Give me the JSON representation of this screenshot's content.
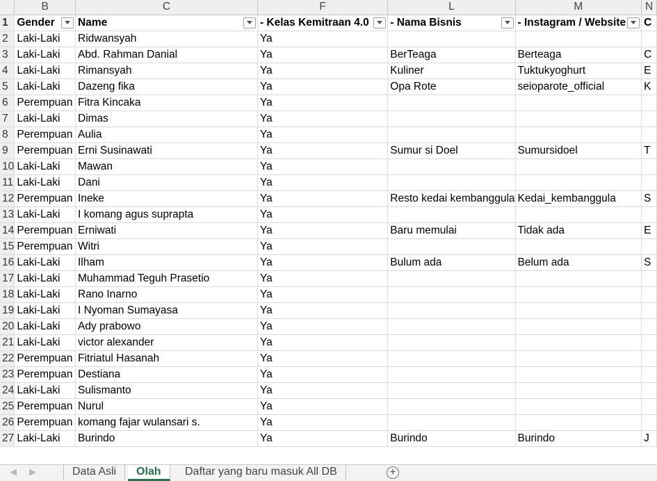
{
  "columns": [
    "B",
    "C",
    "F",
    "L",
    "M",
    "N"
  ],
  "header": {
    "row_number": "1",
    "cells": [
      "Gender",
      "Name",
      "- Kelas Kemitraan 4.0",
      "- Nama Bisnis",
      "- Instagram / Website",
      "C"
    ]
  },
  "rows": [
    {
      "n": "2",
      "cells": [
        "Laki-Laki",
        "Ridwansyah",
        "Ya",
        "",
        "",
        ""
      ]
    },
    {
      "n": "3",
      "cells": [
        "Laki-Laki",
        "Abd. Rahman Danial",
        "Ya",
        "BerTeaga",
        "Berteaga",
        "C"
      ]
    },
    {
      "n": "4",
      "cells": [
        "Laki-Laki",
        "Rimansyah",
        "Ya",
        "Kuliner",
        "Tuktukyoghurt",
        "E"
      ]
    },
    {
      "n": "5",
      "cells": [
        "Laki-Laki",
        "Dazeng fika",
        "Ya",
        "Opa Rote",
        "seioparote_official",
        "K"
      ]
    },
    {
      "n": "6",
      "cells": [
        "Perempuan",
        "Fitra Kincaka",
        "Ya",
        "",
        "",
        ""
      ]
    },
    {
      "n": "7",
      "cells": [
        "Laki-Laki",
        "Dimas",
        "Ya",
        "",
        "",
        ""
      ]
    },
    {
      "n": "8",
      "cells": [
        "Perempuan",
        "Aulia",
        "Ya",
        "",
        "",
        ""
      ]
    },
    {
      "n": "9",
      "cells": [
        "Perempuan",
        "Erni Susinawati",
        "Ya",
        "Sumur si Doel",
        "Sumursidoel",
        "T"
      ]
    },
    {
      "n": "10",
      "cells": [
        "Laki-Laki",
        "Mawan",
        "Ya",
        "",
        "",
        ""
      ]
    },
    {
      "n": "11",
      "cells": [
        "Laki-Laki",
        "Dani",
        "Ya",
        "",
        "",
        ""
      ]
    },
    {
      "n": "12",
      "cells": [
        "Perempuan",
        "Ineke",
        "Ya",
        "Resto kedai kembanggula",
        "Kedai_kembanggula",
        "S"
      ]
    },
    {
      "n": "13",
      "cells": [
        "Laki-Laki",
        "I komang agus suprapta",
        "Ya",
        "",
        "",
        ""
      ]
    },
    {
      "n": "14",
      "cells": [
        "Perempuan",
        "Erniwati",
        "Ya",
        "Baru memulai",
        "Tidak ada",
        "E"
      ]
    },
    {
      "n": "15",
      "cells": [
        "Perempuan",
        "Witri",
        "Ya",
        "",
        "",
        ""
      ]
    },
    {
      "n": "16",
      "cells": [
        "Laki-Laki",
        "Ilham",
        "Ya",
        "Bulum ada",
        "Belum ada",
        "S"
      ]
    },
    {
      "n": "17",
      "cells": [
        "Laki-Laki",
        "Muhammad Teguh Prasetio",
        "Ya",
        "",
        "",
        ""
      ]
    },
    {
      "n": "18",
      "cells": [
        "Laki-Laki",
        "Rano Inarno",
        "Ya",
        "",
        "",
        ""
      ]
    },
    {
      "n": "19",
      "cells": [
        "Laki-Laki",
        "I Nyoman Sumayasa",
        "Ya",
        "",
        "",
        ""
      ]
    },
    {
      "n": "20",
      "cells": [
        "Laki-Laki",
        "Ady prabowo",
        "Ya",
        "",
        "",
        ""
      ]
    },
    {
      "n": "21",
      "cells": [
        "Laki-Laki",
        "victor alexander",
        "Ya",
        "",
        "",
        ""
      ]
    },
    {
      "n": "22",
      "cells": [
        "Perempuan",
        "Fitriatul Hasanah",
        "Ya",
        "",
        "",
        ""
      ]
    },
    {
      "n": "23",
      "cells": [
        "Perempuan",
        "Destiana",
        "Ya",
        "",
        "",
        ""
      ]
    },
    {
      "n": "24",
      "cells": [
        "Laki-Laki",
        "Sulismanto",
        "Ya",
        "",
        "",
        ""
      ]
    },
    {
      "n": "25",
      "cells": [
        "Perempuan",
        "Nurul",
        "Ya",
        "",
        "",
        ""
      ]
    },
    {
      "n": "26",
      "cells": [
        "Perempuan",
        "komang fajar wulansari s.",
        "Ya",
        "",
        "",
        ""
      ]
    },
    {
      "n": "27",
      "cells": [
        "Laki-Laki",
        "Burindo",
        "Ya",
        "Burindo",
        "Burindo",
        "J"
      ]
    }
  ],
  "tabs": {
    "sheet1": "Data Asli",
    "sheet2": "Olah",
    "sheet3": "Daftar yang baru masuk All DB",
    "active": "Olah"
  },
  "colors": {
    "accent": "#217346",
    "header_bg": "#efefef",
    "gridline": "#dadada"
  }
}
